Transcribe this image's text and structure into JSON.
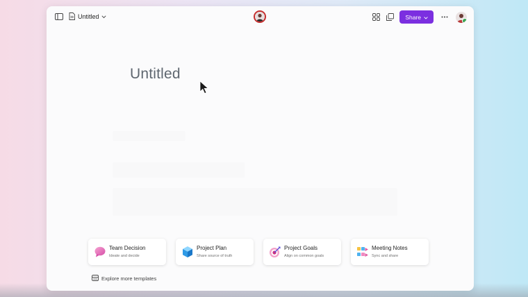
{
  "topbar": {
    "doc_title": "Untitled",
    "share_label": "Share"
  },
  "main": {
    "page_title": "Untitled"
  },
  "templates": [
    {
      "title": "Team Decision",
      "subtitle": "Ideate and decide",
      "icon": "speech-bubble-icon"
    },
    {
      "title": "Project Plan",
      "subtitle": "Share source of truth",
      "icon": "cube-icon"
    },
    {
      "title": "Project Goals",
      "subtitle": "Align on common goals",
      "icon": "target-icon"
    },
    {
      "title": "Meeting Notes",
      "subtitle": "Sync and share",
      "icon": "sticky-notes-icon"
    }
  ],
  "explore_label": "Explore more templates",
  "colors": {
    "accent": "#7b2fe0",
    "avatar_ring": "#c62d2d",
    "presence": "#3aa655"
  }
}
